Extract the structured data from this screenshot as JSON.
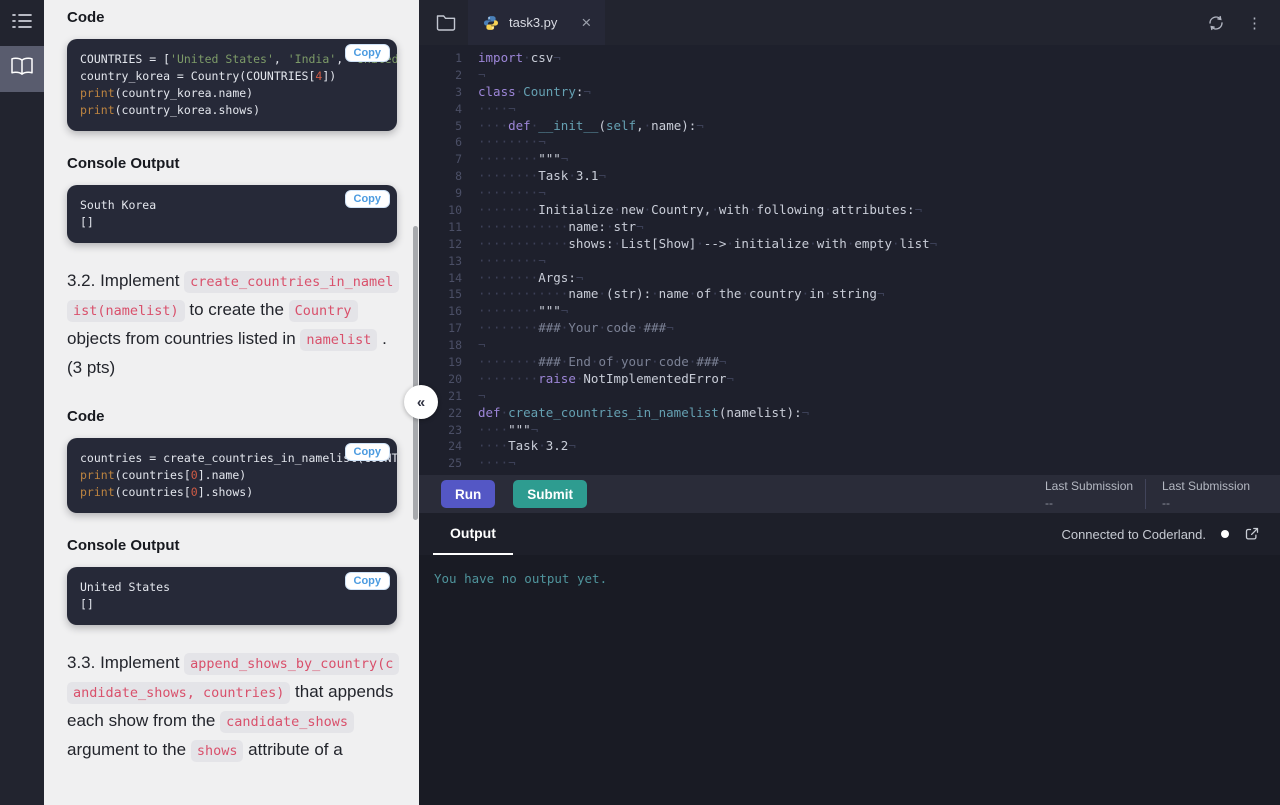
{
  "colors": {
    "run_button": "#5457c5",
    "submit_button": "#2e9c90",
    "inline_code_text": "#d9506b",
    "string_green": "#7d9b68",
    "keyword_purple": "#9d86d8",
    "class_teal": "#65a0b2",
    "number_red": "#cf5b45",
    "builtin_orange": "#bd8440",
    "copy_button_text": "#4b9be0",
    "output_text": "#4f949c"
  },
  "sidebar": {
    "items": [
      {
        "icon": "toc-icon",
        "active": false
      },
      {
        "icon": "book-icon",
        "active": true
      }
    ]
  },
  "instructions": {
    "blocks": [
      {
        "type": "heading",
        "text": "Code"
      },
      {
        "type": "code",
        "copy": "Copy",
        "lines": [
          [
            [
              "t",
              "COUNTRIES = ["
            ],
            [
              "s",
              "'United States'"
            ],
            [
              "t",
              ", "
            ],
            [
              "s",
              "'India'"
            ],
            [
              "t",
              ", "
            ],
            [
              "s",
              "'United"
            ]
          ],
          [
            [
              "t",
              "country_korea = Country(COUNTRIES["
            ],
            [
              "n",
              "4"
            ],
            [
              "t",
              "])"
            ]
          ],
          [
            [
              "fn",
              "print"
            ],
            [
              "t",
              "(country_korea.name)"
            ]
          ],
          [
            [
              "fn",
              "print"
            ],
            [
              "t",
              "(country_korea.shows)"
            ]
          ]
        ]
      },
      {
        "type": "heading",
        "text": "Console Output"
      },
      {
        "type": "console",
        "copy": "Copy",
        "lines": [
          [
            [
              "t",
              "South Korea"
            ]
          ],
          [
            [
              "t",
              "[]"
            ]
          ]
        ]
      },
      {
        "type": "para",
        "segs": [
          [
            "t",
            "3.2. Implement "
          ],
          [
            "c",
            "create_countries_in_namelist(namelist)"
          ],
          [
            "t",
            " to create the "
          ],
          [
            "c",
            "Country"
          ],
          [
            "t",
            " objects from countries listed in "
          ],
          [
            "c",
            "namelist"
          ],
          [
            "t",
            " . (3 pts)"
          ]
        ]
      },
      {
        "type": "heading",
        "text": "Code"
      },
      {
        "type": "code",
        "copy": "Copy",
        "lines": [
          [
            [
              "t",
              "countries = create_countries_in_namelist(COUNTR"
            ]
          ],
          [
            [
              "fn",
              "print"
            ],
            [
              "t",
              "(countries["
            ],
            [
              "n",
              "0"
            ],
            [
              "t",
              "].name)"
            ]
          ],
          [
            [
              "fn",
              "print"
            ],
            [
              "t",
              "(countries["
            ],
            [
              "n",
              "0"
            ],
            [
              "t",
              "].shows)"
            ]
          ]
        ]
      },
      {
        "type": "heading",
        "text": "Console Output"
      },
      {
        "type": "console",
        "copy": "Copy",
        "lines": [
          [
            [
              "t",
              "United States"
            ]
          ],
          [
            [
              "t",
              "[]"
            ]
          ]
        ]
      },
      {
        "type": "para",
        "segs": [
          [
            "t",
            "3.3. Implement "
          ],
          [
            "c",
            "append_shows_by_country(candidate_shows, countries)"
          ],
          [
            "t",
            " that appends each show from the "
          ],
          [
            "c",
            "candidate_shows"
          ],
          [
            "t",
            " argument to the "
          ],
          [
            "c",
            "shows"
          ],
          [
            "t",
            " attribute of a"
          ]
        ]
      }
    ]
  },
  "editor": {
    "tab_filename": "task3.py",
    "collapse_glyph": "«",
    "lines": [
      {
        "n": "1",
        "segs": [
          [
            "k",
            "import"
          ],
          [
            "w",
            "·"
          ],
          [
            "t",
            "csv"
          ],
          [
            "nl",
            "¬"
          ]
        ]
      },
      {
        "n": "2",
        "segs": [
          [
            "nl",
            "¬"
          ]
        ]
      },
      {
        "n": "3",
        "segs": [
          [
            "k",
            "class"
          ],
          [
            "w",
            "·"
          ],
          [
            "f",
            "Country"
          ],
          [
            "t",
            ":"
          ],
          [
            "nl",
            "¬"
          ]
        ]
      },
      {
        "n": "4",
        "segs": [
          [
            "w",
            "····"
          ],
          [
            "nl",
            "¬"
          ]
        ]
      },
      {
        "n": "5",
        "segs": [
          [
            "w",
            "····"
          ],
          [
            "k",
            "def"
          ],
          [
            "w",
            "·"
          ],
          [
            "f",
            "__init__"
          ],
          [
            "t",
            "("
          ],
          [
            "f",
            "self"
          ],
          [
            "t",
            ","
          ],
          [
            "w",
            "·"
          ],
          [
            "t",
            "name):"
          ],
          [
            "nl",
            "¬"
          ]
        ]
      },
      {
        "n": "6",
        "segs": [
          [
            "w",
            "········"
          ],
          [
            "nl",
            "¬"
          ]
        ]
      },
      {
        "n": "7",
        "segs": [
          [
            "w",
            "········"
          ],
          [
            "t",
            "\"\"\""
          ],
          [
            "nl",
            "¬"
          ]
        ]
      },
      {
        "n": "8",
        "segs": [
          [
            "w",
            "········"
          ],
          [
            "t",
            "Task"
          ],
          [
            "w",
            "·"
          ],
          [
            "t",
            "3.1"
          ],
          [
            "nl",
            "¬"
          ]
        ]
      },
      {
        "n": "9",
        "segs": [
          [
            "w",
            "········"
          ],
          [
            "nl",
            "¬"
          ]
        ]
      },
      {
        "n": "10",
        "segs": [
          [
            "w",
            "········"
          ],
          [
            "t",
            "Initialize"
          ],
          [
            "w",
            "·"
          ],
          [
            "t",
            "new"
          ],
          [
            "w",
            "·"
          ],
          [
            "t",
            "Country,"
          ],
          [
            "w",
            "·"
          ],
          [
            "t",
            "with"
          ],
          [
            "w",
            "·"
          ],
          [
            "t",
            "following"
          ],
          [
            "w",
            "·"
          ],
          [
            "t",
            "attributes:"
          ],
          [
            "nl",
            "¬"
          ]
        ]
      },
      {
        "n": "11",
        "segs": [
          [
            "w",
            "············"
          ],
          [
            "t",
            "name:"
          ],
          [
            "w",
            "·"
          ],
          [
            "t",
            "str"
          ],
          [
            "nl",
            "¬"
          ]
        ]
      },
      {
        "n": "12",
        "segs": [
          [
            "w",
            "············"
          ],
          [
            "t",
            "shows:"
          ],
          [
            "w",
            "·"
          ],
          [
            "t",
            "List[Show]"
          ],
          [
            "w",
            "·"
          ],
          [
            "t",
            "-->"
          ],
          [
            "w",
            "·"
          ],
          [
            "t",
            "initialize"
          ],
          [
            "w",
            "·"
          ],
          [
            "t",
            "with"
          ],
          [
            "w",
            "·"
          ],
          [
            "t",
            "empty"
          ],
          [
            "w",
            "·"
          ],
          [
            "t",
            "list"
          ],
          [
            "nl",
            "¬"
          ]
        ]
      },
      {
        "n": "13",
        "segs": [
          [
            "w",
            "········"
          ],
          [
            "nl",
            "¬"
          ]
        ]
      },
      {
        "n": "14",
        "segs": [
          [
            "w",
            "········"
          ],
          [
            "t",
            "Args:"
          ],
          [
            "nl",
            "¬"
          ]
        ]
      },
      {
        "n": "15",
        "segs": [
          [
            "w",
            "············"
          ],
          [
            "t",
            "name"
          ],
          [
            "w",
            "·"
          ],
          [
            "t",
            "(str):"
          ],
          [
            "w",
            "·"
          ],
          [
            "t",
            "name"
          ],
          [
            "w",
            "·"
          ],
          [
            "t",
            "of"
          ],
          [
            "w",
            "·"
          ],
          [
            "t",
            "the"
          ],
          [
            "w",
            "·"
          ],
          [
            "t",
            "country"
          ],
          [
            "w",
            "·"
          ],
          [
            "t",
            "in"
          ],
          [
            "w",
            "·"
          ],
          [
            "t",
            "string"
          ],
          [
            "nl",
            "¬"
          ]
        ]
      },
      {
        "n": "16",
        "segs": [
          [
            "w",
            "········"
          ],
          [
            "t",
            "\"\"\""
          ],
          [
            "nl",
            "¬"
          ]
        ]
      },
      {
        "n": "17",
        "segs": [
          [
            "w",
            "········"
          ],
          [
            "c",
            "###"
          ],
          [
            "w",
            "·"
          ],
          [
            "c",
            "Your"
          ],
          [
            "w",
            "·"
          ],
          [
            "c",
            "code"
          ],
          [
            "w",
            "·"
          ],
          [
            "c",
            "###"
          ],
          [
            "nl",
            "¬"
          ]
        ]
      },
      {
        "n": "18",
        "segs": [
          [
            "nl",
            "¬"
          ]
        ]
      },
      {
        "n": "19",
        "segs": [
          [
            "w",
            "········"
          ],
          [
            "c",
            "###"
          ],
          [
            "w",
            "·"
          ],
          [
            "c",
            "End"
          ],
          [
            "w",
            "·"
          ],
          [
            "c",
            "of"
          ],
          [
            "w",
            "·"
          ],
          [
            "c",
            "your"
          ],
          [
            "w",
            "·"
          ],
          [
            "c",
            "code"
          ],
          [
            "w",
            "·"
          ],
          [
            "c",
            "###"
          ],
          [
            "nl",
            "¬"
          ]
        ]
      },
      {
        "n": "20",
        "segs": [
          [
            "w",
            "········"
          ],
          [
            "k",
            "raise"
          ],
          [
            "w",
            "·"
          ],
          [
            "t",
            "NotImplementedError"
          ],
          [
            "nl",
            "¬"
          ]
        ]
      },
      {
        "n": "21",
        "segs": [
          [
            "nl",
            "¬"
          ]
        ]
      },
      {
        "n": "22",
        "segs": [
          [
            "k",
            "def"
          ],
          [
            "w",
            "·"
          ],
          [
            "f",
            "create_countries_in_namelist"
          ],
          [
            "t",
            "(namelist):"
          ],
          [
            "nl",
            "¬"
          ]
        ]
      },
      {
        "n": "23",
        "segs": [
          [
            "w",
            "····"
          ],
          [
            "t",
            "\"\"\""
          ],
          [
            "nl",
            "¬"
          ]
        ]
      },
      {
        "n": "24",
        "segs": [
          [
            "w",
            "····"
          ],
          [
            "t",
            "Task"
          ],
          [
            "w",
            "·"
          ],
          [
            "t",
            "3.2"
          ],
          [
            "nl",
            "¬"
          ]
        ]
      },
      {
        "n": "25",
        "segs": [
          [
            "w",
            "····"
          ],
          [
            "nl",
            "¬"
          ]
        ]
      }
    ]
  },
  "actions": {
    "run_label": "Run",
    "submit_label": "Submit",
    "last_submissions": [
      {
        "label": "Last Submission",
        "value": "--"
      },
      {
        "label": "Last Submission",
        "value": "--"
      }
    ]
  },
  "output": {
    "tab_label": "Output",
    "status_text": "Connected to Coderland.",
    "empty_message": "You have no output yet."
  }
}
